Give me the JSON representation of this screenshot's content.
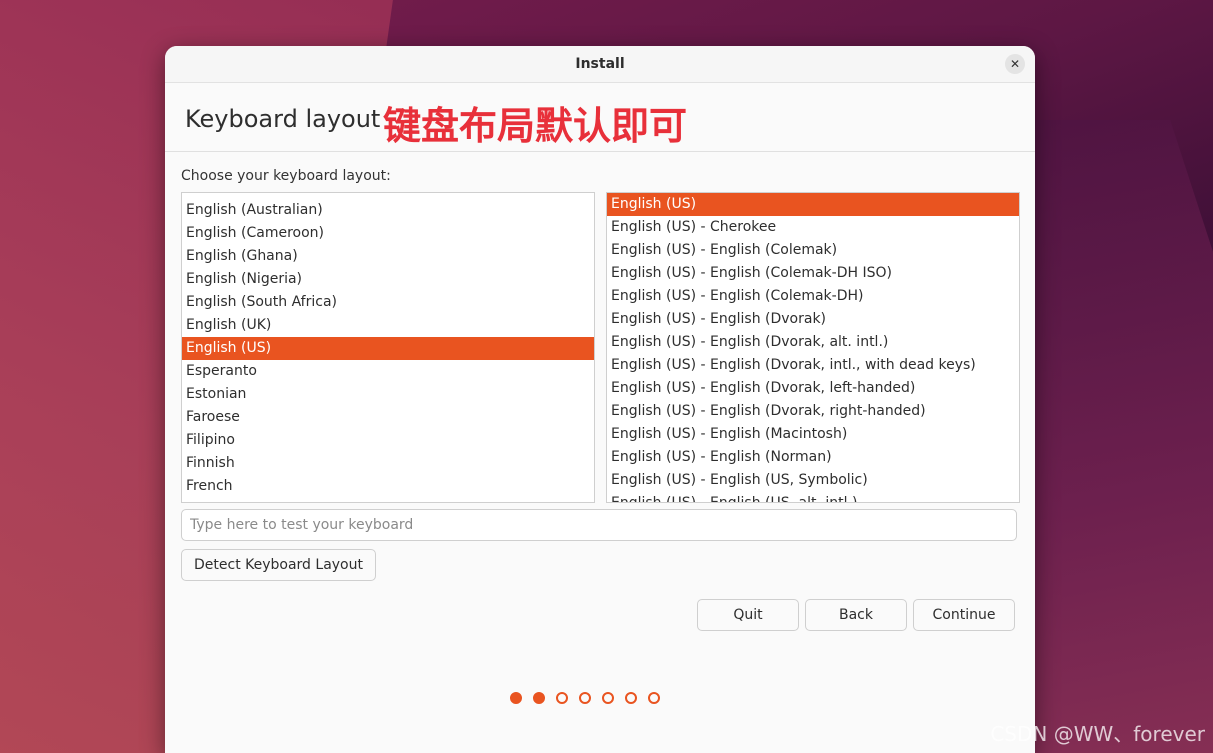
{
  "window": {
    "title": "Install"
  },
  "header": {
    "title": "Keyboard layout",
    "annotation": "键盘布局默认即可"
  },
  "prompt": "Choose your keyboard layout:",
  "layouts": [
    "English (Australian)",
    "English (Cameroon)",
    "English (Ghana)",
    "English (Nigeria)",
    "English (South Africa)",
    "English (UK)",
    "English (US)",
    "Esperanto",
    "Estonian",
    "Faroese",
    "Filipino",
    "Finnish",
    "French"
  ],
  "selected_layout": "English (US)",
  "variants": [
    "English (US)",
    "English (US) - Cherokee",
    "English (US) - English (Colemak)",
    "English (US) - English (Colemak-DH ISO)",
    "English (US) - English (Colemak-DH)",
    "English (US) - English (Dvorak)",
    "English (US) - English (Dvorak, alt. intl.)",
    "English (US) - English (Dvorak, intl., with dead keys)",
    "English (US) - English (Dvorak, left-handed)",
    "English (US) - English (Dvorak, right-handed)",
    "English (US) - English (Macintosh)",
    "English (US) - English (Norman)",
    "English (US) - English (US, Symbolic)",
    "English (US) - English (US, alt. intl.)"
  ],
  "selected_variant": "English (US)",
  "test_input": {
    "placeholder": "Type here to test your keyboard",
    "value": ""
  },
  "buttons": {
    "detect": "Detect Keyboard Layout",
    "quit": "Quit",
    "back": "Back",
    "continue": "Continue"
  },
  "progress": {
    "total_steps": 7,
    "completed_steps": 2
  },
  "watermark": "CSDN @WW、forever",
  "colors": {
    "accent": "#e95420",
    "annotation": "#e8303a"
  },
  "icons": {
    "close": "close-icon"
  }
}
